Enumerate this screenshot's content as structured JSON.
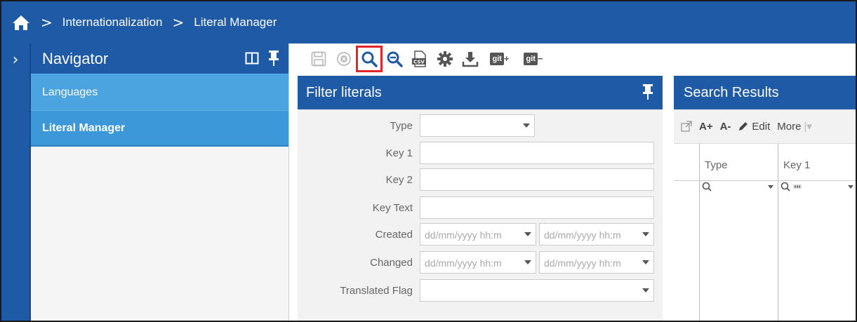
{
  "breadcrumb": {
    "items": [
      "Internationalization",
      "Literal Manager"
    ],
    "separator": ">"
  },
  "navigator": {
    "title": "Navigator",
    "items": [
      {
        "label": "Languages",
        "active": false
      },
      {
        "label": "Literal Manager",
        "active": true
      }
    ]
  },
  "toolbar": {
    "buttons": [
      "save-icon",
      "cancel-icon",
      "search-icon",
      "zoom-out-icon",
      "csv-export-icon",
      "gear-icon",
      "download-icon",
      "git-push-icon",
      "git-pull-icon"
    ],
    "git_label": "git",
    "highlighted": "search-icon"
  },
  "filter": {
    "title": "Filter literals",
    "fields": {
      "type": {
        "label": "Type",
        "value": ""
      },
      "key1": {
        "label": "Key 1",
        "value": ""
      },
      "key2": {
        "label": "Key 2",
        "value": ""
      },
      "key_text": {
        "label": "Key Text",
        "value": ""
      },
      "created": {
        "label": "Created",
        "from_placeholder": "dd/mm/yyyy hh:m",
        "to_placeholder": "dd/mm/yyyy hh:m"
      },
      "changed": {
        "label": "Changed",
        "from_placeholder": "dd/mm/yyyy hh:m",
        "to_placeholder": "dd/mm/yyyy hh:m"
      },
      "translated_flag": {
        "label": "Translated Flag",
        "value": ""
      }
    }
  },
  "results": {
    "title": "Search Results",
    "tools": {
      "font_increase": "A+",
      "font_decrease": "A-",
      "edit": "Edit",
      "more": "More"
    },
    "columns": [
      "Type",
      "Key 1"
    ]
  },
  "colors": {
    "primary": "#1f5aa6",
    "nav_item": "#4ba3df",
    "highlight": "#e0262b"
  }
}
